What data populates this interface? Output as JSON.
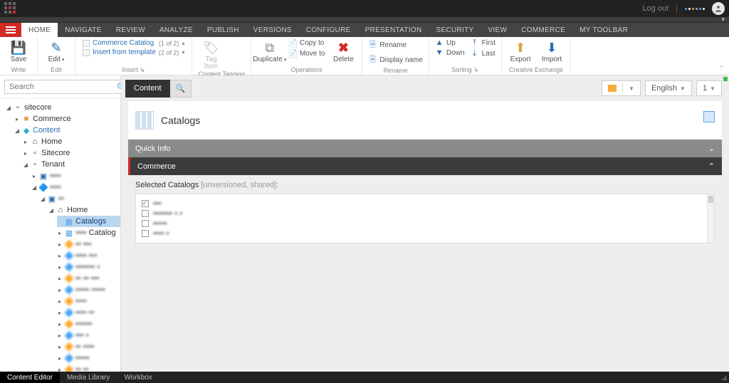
{
  "topbar": {
    "logout": "Log out"
  },
  "menubar": {
    "tabs": [
      "HOME",
      "NAVIGATE",
      "REVIEW",
      "ANALYZE",
      "PUBLISH",
      "VERSIONS",
      "CONFIGURE",
      "PRESENTATION",
      "SECURITY",
      "VIEW",
      "COMMERCE",
      "MY TOOLBAR"
    ],
    "active": "HOME"
  },
  "ribbon": {
    "write": {
      "save": "Save",
      "label": "Write"
    },
    "edit": {
      "edit": "Edit",
      "label": "Edit"
    },
    "insert": {
      "row1_label": "Commerce Catalog",
      "row1_count": "(1 of 2)",
      "row2_label": "Insert from template",
      "row2_count": "(2 of 2)",
      "label": "Insert"
    },
    "tagging": {
      "tag": "Tag Item",
      "label": "Content Tagging"
    },
    "operations": {
      "duplicate": "Duplicate",
      "copy": "Copy to",
      "move": "Move to",
      "delete": "Delete",
      "label": "Operations"
    },
    "rename": {
      "rename": "Rename",
      "display": "Display name",
      "label": "Rename"
    },
    "sorting": {
      "up": "Up",
      "down": "Down",
      "first": "First",
      "last": "Last",
      "label": "Sorting"
    },
    "exchange": {
      "export": "Export",
      "import": "Import",
      "label": "Creative Exchange"
    }
  },
  "search": {
    "placeholder": "Search"
  },
  "tree": {
    "root": "sitecore",
    "commerce": "Commerce",
    "content": "Content",
    "home": "Home",
    "sitecore_node": "Sitecore",
    "tenant": "Tenant",
    "catalogs": "Catalogs",
    "catalog_item": "Catalog"
  },
  "content_tab": {
    "content": "Content"
  },
  "right_controls": {
    "lang": "English",
    "ver": "1"
  },
  "titlecard": {
    "title": "Catalogs"
  },
  "accordions": {
    "quick": "Quick Info",
    "commerce": "Commerce"
  },
  "field": {
    "label": "Selected Catalogs",
    "meta": "[unversioned, shared]:"
  },
  "status": {
    "content_editor": "Content Editor",
    "media": "Media Library",
    "workbox": "Workbox"
  }
}
